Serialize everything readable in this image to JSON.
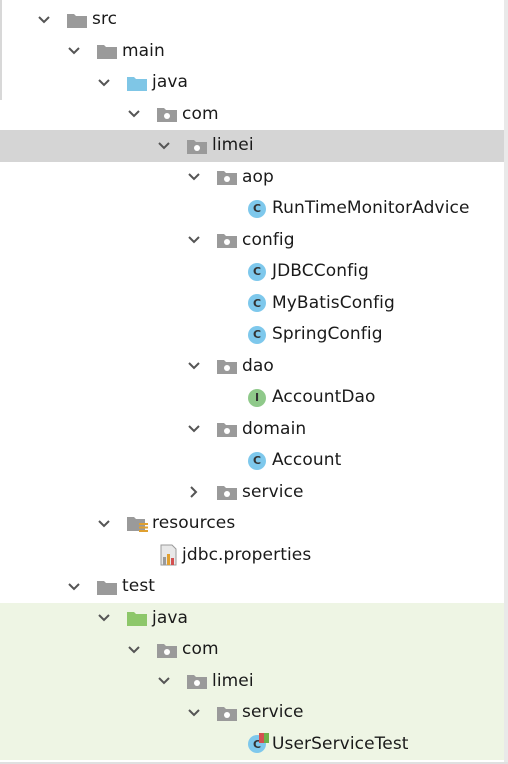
{
  "tree": {
    "nodes": [
      {
        "label": "src",
        "icon": "folder-icon",
        "expanded": true
      },
      {
        "label": "main",
        "icon": "folder-icon",
        "expanded": true
      },
      {
        "label": "java",
        "icon": "source-root-folder-icon",
        "expanded": true
      },
      {
        "label": "com",
        "icon": "package-icon",
        "expanded": true
      },
      {
        "label": "limei",
        "icon": "package-icon",
        "expanded": true,
        "selected": true
      },
      {
        "label": "aop",
        "icon": "package-icon",
        "expanded": true
      },
      {
        "label": "RunTimeMonitorAdvice",
        "icon": "class-icon"
      },
      {
        "label": "config",
        "icon": "package-icon",
        "expanded": true
      },
      {
        "label": "JDBCConfig",
        "icon": "class-icon"
      },
      {
        "label": "MyBatisConfig",
        "icon": "class-icon"
      },
      {
        "label": "SpringConfig",
        "icon": "class-icon"
      },
      {
        "label": "dao",
        "icon": "package-icon",
        "expanded": true
      },
      {
        "label": "AccountDao",
        "icon": "interface-icon",
        "icon_letter": "I"
      },
      {
        "label": "domain",
        "icon": "package-icon",
        "expanded": true
      },
      {
        "label": "Account",
        "icon": "class-icon"
      },
      {
        "label": "service",
        "icon": "package-icon",
        "expanded": false
      },
      {
        "label": "resources",
        "icon": "resources-folder-icon",
        "expanded": true
      },
      {
        "label": "jdbc.properties",
        "icon": "properties-file-icon"
      },
      {
        "label": "test",
        "icon": "folder-icon",
        "expanded": true
      },
      {
        "label": "java",
        "icon": "test-source-root-folder-icon",
        "expanded": true
      },
      {
        "label": "com",
        "icon": "package-icon",
        "expanded": true
      },
      {
        "label": "limei",
        "icon": "package-icon",
        "expanded": true
      },
      {
        "label": "service",
        "icon": "package-icon",
        "expanded": true
      },
      {
        "label": "UserServiceTest",
        "icon": "test-class-icon"
      }
    ],
    "class_letter": "C"
  },
  "colors": {
    "selected_row": "#d5d5d5",
    "test_background": "#eef5e4",
    "folder_grey": "#9a9a9a",
    "source_root_blue": "#7fc6e6",
    "test_root_green": "#8dc76a",
    "class_circle": "#7ec8ec",
    "interface_circle": "#8fc98a"
  }
}
